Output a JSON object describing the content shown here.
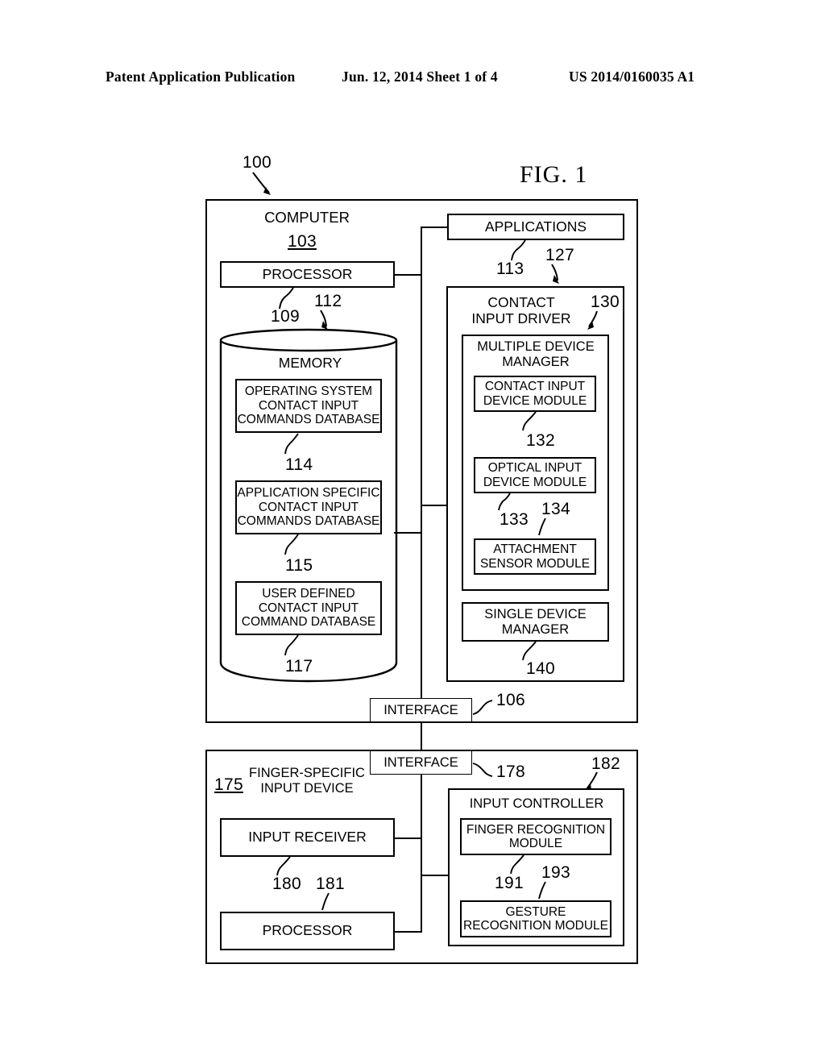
{
  "header": {
    "left": "Patent Application Publication",
    "middle": "Jun. 12, 2014  Sheet 1 of 4",
    "right": "US 2014/0160035 A1"
  },
  "figure": {
    "label": "FIG. 1",
    "system_ref": "100"
  },
  "computer": {
    "title": "COMPUTER",
    "ref": "103",
    "processor": {
      "label": "PROCESSOR",
      "ref": "109"
    },
    "memory": {
      "label": "MEMORY",
      "ref": "112",
      "databases": [
        {
          "label": "OPERATING SYSTEM\nCONTACT INPUT\nCOMMANDS DATABASE",
          "ref": "114"
        },
        {
          "label": "APPLICATION SPECIFIC\nCONTACT INPUT\nCOMMANDS DATABASE",
          "ref": "115"
        },
        {
          "label": "USER DEFINED\nCONTACT INPUT\nCOMMAND DATABASE",
          "ref": "117"
        }
      ]
    },
    "applications": {
      "label": "APPLICATIONS",
      "ref": "113"
    },
    "contact_input_driver": {
      "label": "CONTACT\nINPUT DRIVER",
      "ref": "127",
      "multiple_device_manager": {
        "label": "MULTIPLE DEVICE\nMANAGER",
        "ref": "130",
        "modules": [
          {
            "label": "CONTACT INPUT\nDEVICE MODULE",
            "ref": "132"
          },
          {
            "label": "OPTICAL INPUT\nDEVICE MODULE",
            "ref": "133"
          },
          {
            "label": "ATTACHMENT\nSENSOR MODULE",
            "ref": "134"
          }
        ]
      },
      "single_device_manager": {
        "label": "SINGLE DEVICE\nMANAGER",
        "ref": "140"
      }
    },
    "interface": {
      "label": "INTERFACE",
      "ref": "106"
    }
  },
  "input_device": {
    "title": "FINGER-SPECIFIC\nINPUT DEVICE",
    "ref": "175",
    "interface": {
      "label": "INTERFACE",
      "ref": "178"
    },
    "input_receiver": {
      "label": "INPUT RECEIVER",
      "ref": "180"
    },
    "processor": {
      "label": "PROCESSOR",
      "ref": "181"
    },
    "input_controller": {
      "label": "INPUT CONTROLLER",
      "ref": "182",
      "modules": [
        {
          "label": "FINGER RECOGNITION\nMODULE",
          "ref": "191"
        },
        {
          "label": "GESTURE\nRECOGNITION MODULE",
          "ref": "193"
        }
      ]
    }
  },
  "colors": {
    "ink": "#000000",
    "paper": "#ffffff"
  }
}
